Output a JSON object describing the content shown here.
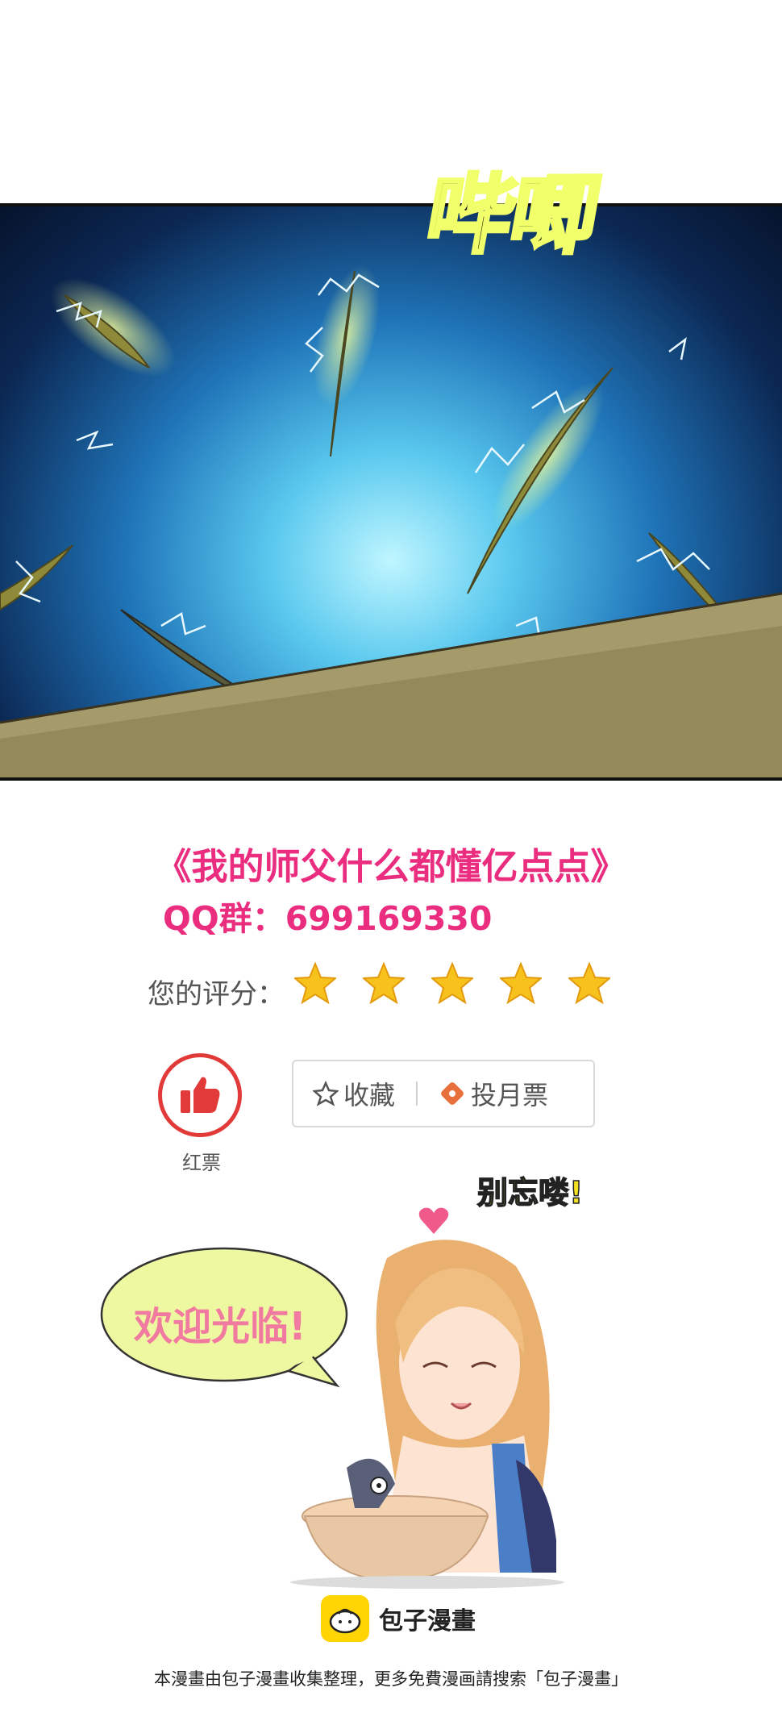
{
  "panel": {
    "sfx_text": "哔唧"
  },
  "promo": {
    "title": "《我的师父什么都懂亿点点》",
    "qq_group": "QQ群：699169330"
  },
  "rating": {
    "label": "您的评分：",
    "stars": 5
  },
  "actions": {
    "like_label": "红票",
    "favorite_label": "收藏",
    "vote_label": "投月票"
  },
  "mascot": {
    "reminder": "别忘喽!",
    "speech": "欢迎光临!"
  },
  "brand": {
    "name": "包子漫畫"
  },
  "footer": {
    "notice": "本漫畫由包子漫畫收集整理，更多免費漫画請搜索「包子漫畫」"
  },
  "colors": {
    "accent_pink": "#ea2d7f",
    "star_yellow": "#f8c21c",
    "like_red": "#e23a38",
    "brand_yellow": "#ffd400"
  },
  "icons": [
    "star-icon",
    "thumbs-up-icon",
    "star-outline-icon",
    "ticket-icon",
    "heart-icon",
    "bun-logo-icon"
  ]
}
